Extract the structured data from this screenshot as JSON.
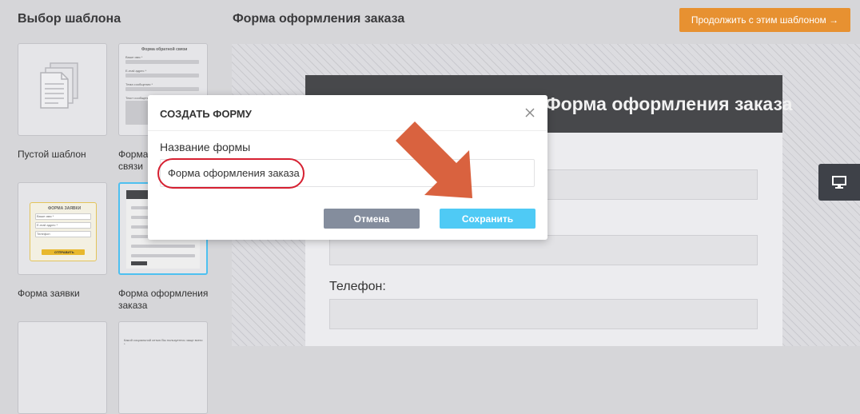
{
  "left_panel": {
    "title": "Выбор шаблона",
    "templates": [
      {
        "label": "Пустой шаблон"
      },
      {
        "label": "Форма обратной связи",
        "thumb_title": "Форма обратной связи",
        "thumb_fields": [
          "Ваше имя *",
          "E-mail адрес *",
          "Тема сообщения *",
          "Текст сообщения *"
        ]
      },
      {
        "label": "Форма заявки",
        "thumb_title": "ФОРМА ЗАЯВКИ",
        "thumb_fields": [
          "Ваше имя *",
          "E-mail адрес *",
          "Телефон"
        ],
        "thumb_button": "ОТПРАВИТЬ"
      },
      {
        "label": "Форма оформления заказа"
      },
      {
        "label": ""
      },
      {
        "label": "",
        "thumb_text": "Какой социальной сетью Вы пользуетесь чаще всего *"
      }
    ]
  },
  "main": {
    "title": "Форма оформления заказа",
    "continue_button": "Продолжить с этим шаблоном →",
    "preview": {
      "header_title": "Форма оформления заказа",
      "phone_label": "Телефон:"
    }
  },
  "modal": {
    "title": "СОЗДАТЬ ФОРМУ",
    "field_label": "Название формы",
    "field_value": "Форма оформления заказа",
    "cancel_label": "Отмена",
    "save_label": "Сохранить"
  },
  "colors": {
    "accent_orange": "#e79131",
    "save_blue": "#4fcaf5",
    "cancel_gray": "#848d9d",
    "highlight_red": "#d62031",
    "arrow": "#d9623f"
  },
  "icons": {
    "modal_close": "close-icon",
    "device_toggle": "desktop-monitor-icon",
    "blank_template": "document-pages-icon",
    "annotation": "arrow-icon"
  }
}
